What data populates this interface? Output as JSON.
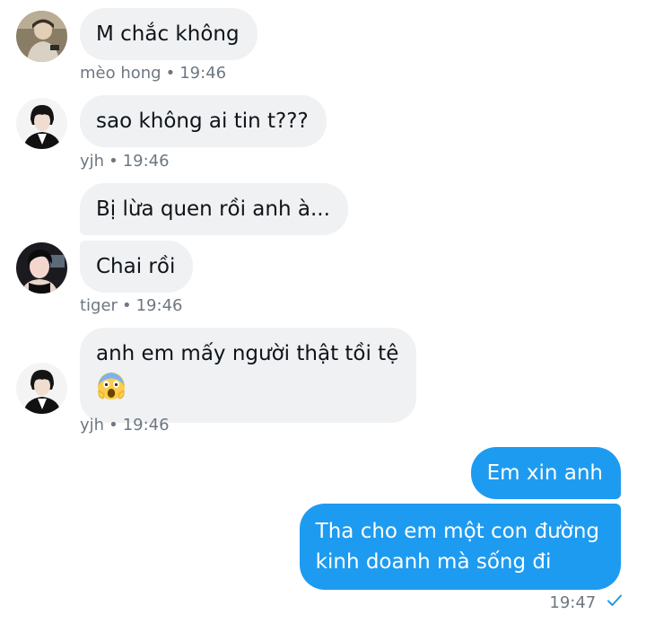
{
  "messages": [
    {
      "text": "M chắc không",
      "sender": "mèo hong",
      "time": "19:46"
    },
    {
      "text": "sao không ai tin t???",
      "sender": "yjh",
      "time": "19:46"
    },
    {
      "text": "Bị lừa quen rồi anh à...",
      "sender": "tiger"
    },
    {
      "text": "Chai rồi",
      "sender": "tiger",
      "time": "19:46"
    },
    {
      "text": "anh em mấy người thật tồi tệ",
      "emoji": "face-screaming-in-fear",
      "sender": "yjh",
      "time": "19:46"
    }
  ],
  "outgoing": [
    {
      "text": "Em xin anh"
    },
    {
      "line1": "Tha cho em một con đường",
      "line2": "kinh doanh mà sống đi"
    }
  ],
  "outgoing_time": "19:47",
  "meta_separator": "•",
  "colors": {
    "incoming_bubble": "#eff1f3",
    "outgoing_bubble": "#1d9bf0",
    "meta_text": "#6e7781"
  },
  "icons": {
    "read_receipt": "check-icon"
  }
}
